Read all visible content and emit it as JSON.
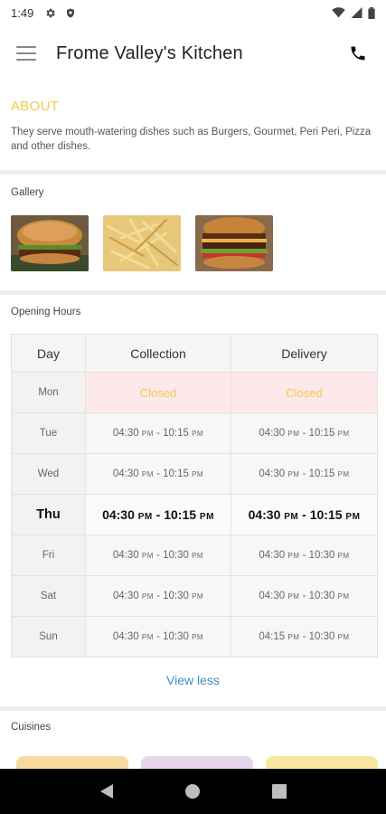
{
  "status_bar": {
    "time": "1:49",
    "icons": [
      "gear-icon",
      "shield-icon",
      "wifi-icon",
      "signal-icon",
      "battery-icon"
    ]
  },
  "app_bar": {
    "title": "Frome Valley's Kitchen",
    "menu_icon": "hamburger-icon",
    "call_icon": "phone-icon"
  },
  "about": {
    "heading": "ABOUT",
    "text": "They serve mouth-watering dishes such as Burgers, Gourmet, Peri Peri, Pizza and other dishes."
  },
  "gallery": {
    "label": "Gallery",
    "images": [
      "burger-photo",
      "fries-photo",
      "double-burger-photo"
    ]
  },
  "opening_hours": {
    "label": "Opening Hours",
    "headers": {
      "day": "Day",
      "collection": "Collection",
      "delivery": "Delivery"
    },
    "rows": [
      {
        "day": "Mon",
        "c_start": "Closed",
        "c_end": "",
        "d_start": "Closed",
        "d_end": ""
      },
      {
        "day": "Tue",
        "c_start": "04:30",
        "c_end": "10:15",
        "d_start": "04:30",
        "d_end": "10:15"
      },
      {
        "day": "Wed",
        "c_start": "04:30",
        "c_end": "10:15",
        "d_start": "04:30",
        "d_end": "10:15"
      },
      {
        "day": "Thu",
        "c_start": "04:30",
        "c_end": "10:15",
        "d_start": "04:30",
        "d_end": "10:15"
      },
      {
        "day": "Fri",
        "c_start": "04:30",
        "c_end": "10:30",
        "d_start": "04:30",
        "d_end": "10:30"
      },
      {
        "day": "Sat",
        "c_start": "04:30",
        "c_end": "10:30",
        "d_start": "04:30",
        "d_end": "10:30"
      },
      {
        "day": "Sun",
        "c_start": "04:30",
        "c_end": "10:30",
        "d_start": "04:15",
        "d_end": "10:30"
      }
    ],
    "pm": "PM",
    "dash": " - ",
    "view_less": "View less"
  },
  "cuisines": {
    "label": "Cuisines",
    "chip_colors": [
      "#f8d9a0",
      "#e6d6ec",
      "#f9e7a0"
    ]
  },
  "colors": {
    "accent": "#f2c94c",
    "link": "#3b8ec7",
    "closed_bg": "#fde9ea"
  }
}
